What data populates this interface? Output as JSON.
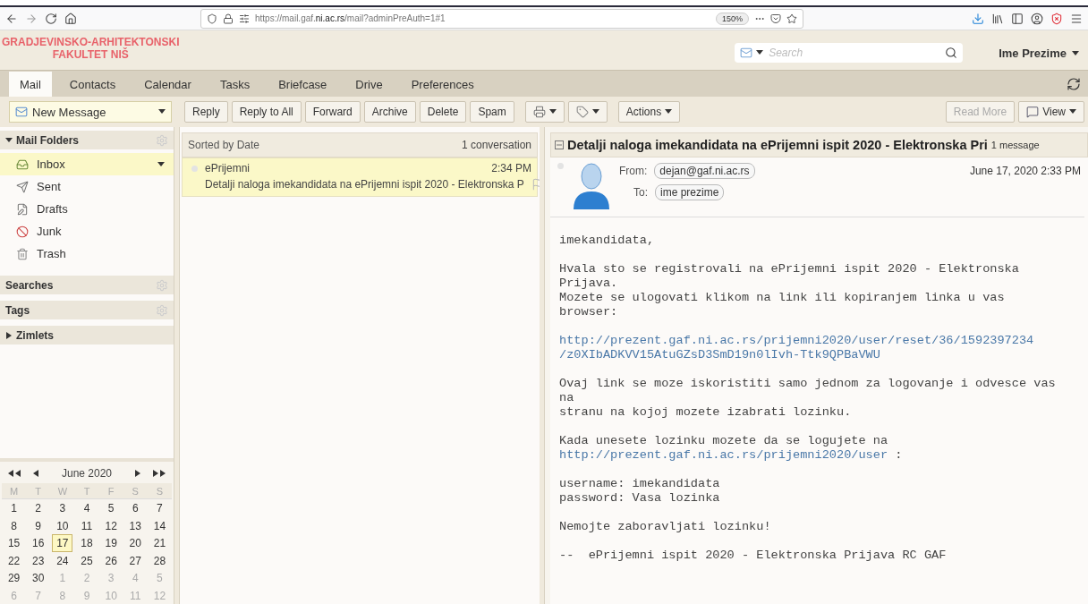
{
  "browser": {
    "url": "https://mail.gaf.**ni.ac.rs**/mail?adminPreAuth=1#1",
    "zoom": "150%"
  },
  "header": {
    "logo": [
      "GRADJEVINSKO-ARHITEKTONSKI",
      "FAKULTET NIŠ"
    ],
    "search": {
      "placeholder": "Search"
    },
    "user": "Ime Prezime"
  },
  "tabs": [
    {
      "label": "Mail",
      "selected": true
    },
    {
      "label": "Contacts",
      "selected": false
    },
    {
      "label": "Calendar",
      "selected": false
    },
    {
      "label": "Tasks",
      "selected": false
    },
    {
      "label": "Briefcase",
      "selected": false
    },
    {
      "label": "Drive",
      "selected": false
    },
    {
      "label": "Preferences",
      "selected": false
    }
  ],
  "toolbar": {
    "new_message": "New Message",
    "buttons": [
      {
        "kind": "text",
        "label": "Reply",
        "disabled": false
      },
      {
        "kind": "text",
        "label": "Reply to All",
        "disabled": false
      },
      {
        "kind": "text",
        "label": "Forward",
        "disabled": false
      },
      {
        "kind": "text",
        "label": "Archive",
        "disabled": false
      },
      {
        "kind": "text",
        "label": "Delete",
        "disabled": false
      },
      {
        "kind": "text",
        "label": "Spam",
        "disabled": false
      },
      {
        "kind": "print",
        "disabled": false
      },
      {
        "kind": "tag",
        "disabled": false
      },
      {
        "kind": "menu",
        "label": "Actions",
        "disabled": false
      }
    ],
    "right": [
      {
        "kind": "text",
        "label": "Read More",
        "disabled": true
      },
      {
        "kind": "view",
        "label": "View",
        "disabled": false
      }
    ]
  },
  "sidebar": {
    "mail_folders": {
      "title": "Mail Folders",
      "expanded": true
    },
    "folders": [
      {
        "kind": "inbox",
        "label": "Inbox",
        "selected": true
      },
      {
        "kind": "sent",
        "label": "Sent",
        "selected": false
      },
      {
        "kind": "drafts",
        "label": "Drafts",
        "selected": false
      },
      {
        "kind": "junk",
        "label": "Junk",
        "selected": false
      },
      {
        "kind": "trash",
        "label": "Trash",
        "selected": false
      }
    ],
    "sections": [
      {
        "title": "Searches",
        "kind": "gear"
      },
      {
        "title": "Tags",
        "kind": "gear"
      },
      {
        "title": "Zimlets",
        "kind": "collapsed"
      }
    ]
  },
  "calendar": {
    "title": "June 2020",
    "weekdays": [
      "M",
      "T",
      "W",
      "T",
      "F",
      "S",
      "S"
    ],
    "days": [
      {
        "text": "1",
        "kind": "current",
        "selected": false
      },
      {
        "text": "2",
        "kind": "current",
        "selected": false
      },
      {
        "text": "3",
        "kind": "current",
        "selected": false
      },
      {
        "text": "4",
        "kind": "current",
        "selected": false
      },
      {
        "text": "5",
        "kind": "current",
        "selected": false
      },
      {
        "text": "6",
        "kind": "current",
        "selected": false
      },
      {
        "text": "7",
        "kind": "current",
        "selected": false
      },
      {
        "text": "8",
        "kind": "current",
        "selected": false
      },
      {
        "text": "9",
        "kind": "current",
        "selected": false
      },
      {
        "text": "10",
        "kind": "current",
        "selected": false
      },
      {
        "text": "11",
        "kind": "current",
        "selected": false
      },
      {
        "text": "12",
        "kind": "current",
        "selected": false
      },
      {
        "text": "13",
        "kind": "current",
        "selected": false
      },
      {
        "text": "14",
        "kind": "current",
        "selected": false
      },
      {
        "text": "15",
        "kind": "current",
        "selected": false
      },
      {
        "text": "16",
        "kind": "current",
        "selected": false
      },
      {
        "text": "17",
        "kind": "current",
        "selected": true
      },
      {
        "text": "18",
        "kind": "current",
        "selected": false
      },
      {
        "text": "19",
        "kind": "current",
        "selected": false
      },
      {
        "text": "20",
        "kind": "current",
        "selected": false
      },
      {
        "text": "21",
        "kind": "current",
        "selected": false
      },
      {
        "text": "22",
        "kind": "current",
        "selected": false
      },
      {
        "text": "23",
        "kind": "current",
        "selected": false
      },
      {
        "text": "24",
        "kind": "current",
        "selected": false
      },
      {
        "text": "25",
        "kind": "current",
        "selected": false
      },
      {
        "text": "26",
        "kind": "current",
        "selected": false
      },
      {
        "text": "27",
        "kind": "current",
        "selected": false
      },
      {
        "text": "28",
        "kind": "current",
        "selected": false
      },
      {
        "text": "29",
        "kind": "current",
        "selected": false
      },
      {
        "text": "30",
        "kind": "current",
        "selected": false
      },
      {
        "text": "1",
        "kind": "other",
        "selected": false
      },
      {
        "text": "2",
        "kind": "other",
        "selected": false
      },
      {
        "text": "3",
        "kind": "other",
        "selected": false
      },
      {
        "text": "4",
        "kind": "other",
        "selected": false
      },
      {
        "text": "5",
        "kind": "other",
        "selected": false
      },
      {
        "text": "6",
        "kind": "other",
        "selected": false
      },
      {
        "text": "7",
        "kind": "other",
        "selected": false
      },
      {
        "text": "8",
        "kind": "other",
        "selected": false
      },
      {
        "text": "9",
        "kind": "other",
        "selected": false
      },
      {
        "text": "10",
        "kind": "other",
        "selected": false
      },
      {
        "text": "11",
        "kind": "other",
        "selected": false
      },
      {
        "text": "12",
        "kind": "other",
        "selected": false
      }
    ]
  },
  "list": {
    "sort": "Sorted by Date",
    "count": "1 conversation",
    "conversations": [
      {
        "sender": "ePrijemni",
        "time": "2:34 PM",
        "subject": "Detalji naloga imekandidata na ePrijemni ispit 2020 - Elektronska P",
        "selected": true
      }
    ]
  },
  "reading": {
    "subject": "Detalji naloga imekandidata na ePrijemni ispit 2020 - Elektronska Pri",
    "count": "1 message",
    "from_label": "From:",
    "from": "dejan@gaf.ni.ac.rs",
    "to_label": "To:",
    "to": "ime prezime",
    "date": "June 17, 2020 2:33 PM",
    "body": [
      [
        {
          "kind": "text",
          "text": "imekandidata,"
        }
      ],
      [
        {
          "kind": "text",
          "text": "Hvala sto se registrovali na ePrijemni ispit 2020 - Elektronska"
        },
        {
          "kind": "text",
          "text": "Prijava."
        },
        {
          "kind": "text",
          "text": "Mozete se ulogovati klikom na link ili kopiranjem linka u vas"
        },
        {
          "kind": "text",
          "text": "browser:"
        }
      ],
      [
        {
          "kind": "link",
          "text": "http://prezent.gaf.ni.ac.rs/prijemni2020/user/reset/36/1592397234"
        },
        {
          "kind": "link",
          "text": "/z0XIbADKVV15AtuGZsD3SmD19n0lIvh-Ttk9QPBaVWU"
        }
      ],
      [
        {
          "kind": "text",
          "text": "Ovaj link se moze iskoristiti samo jednom za logovanje i odvesce vas"
        },
        {
          "kind": "text",
          "text": "na"
        },
        {
          "kind": "text",
          "text": "stranu na kojoj mozete izabrati lozinku."
        }
      ],
      [
        {
          "kind": "text",
          "text": "Kada unesete lozinku mozete da se logujete na"
        },
        {
          "kind": "link",
          "text": "http://prezent.gaf.ni.ac.rs/prijemni2020/user",
          "suffix": " :"
        }
      ],
      [
        {
          "kind": "text",
          "text": "username: imekandidata"
        },
        {
          "kind": "text",
          "text": "password: Vasa lozinka"
        }
      ],
      [
        {
          "kind": "text",
          "text": "Nemojte zaboravljati lozinku!"
        }
      ],
      [
        {
          "kind": "text",
          "text": "--  ePrijemni ispit 2020 - Elektronska Prijava RC GAF"
        }
      ]
    ]
  }
}
